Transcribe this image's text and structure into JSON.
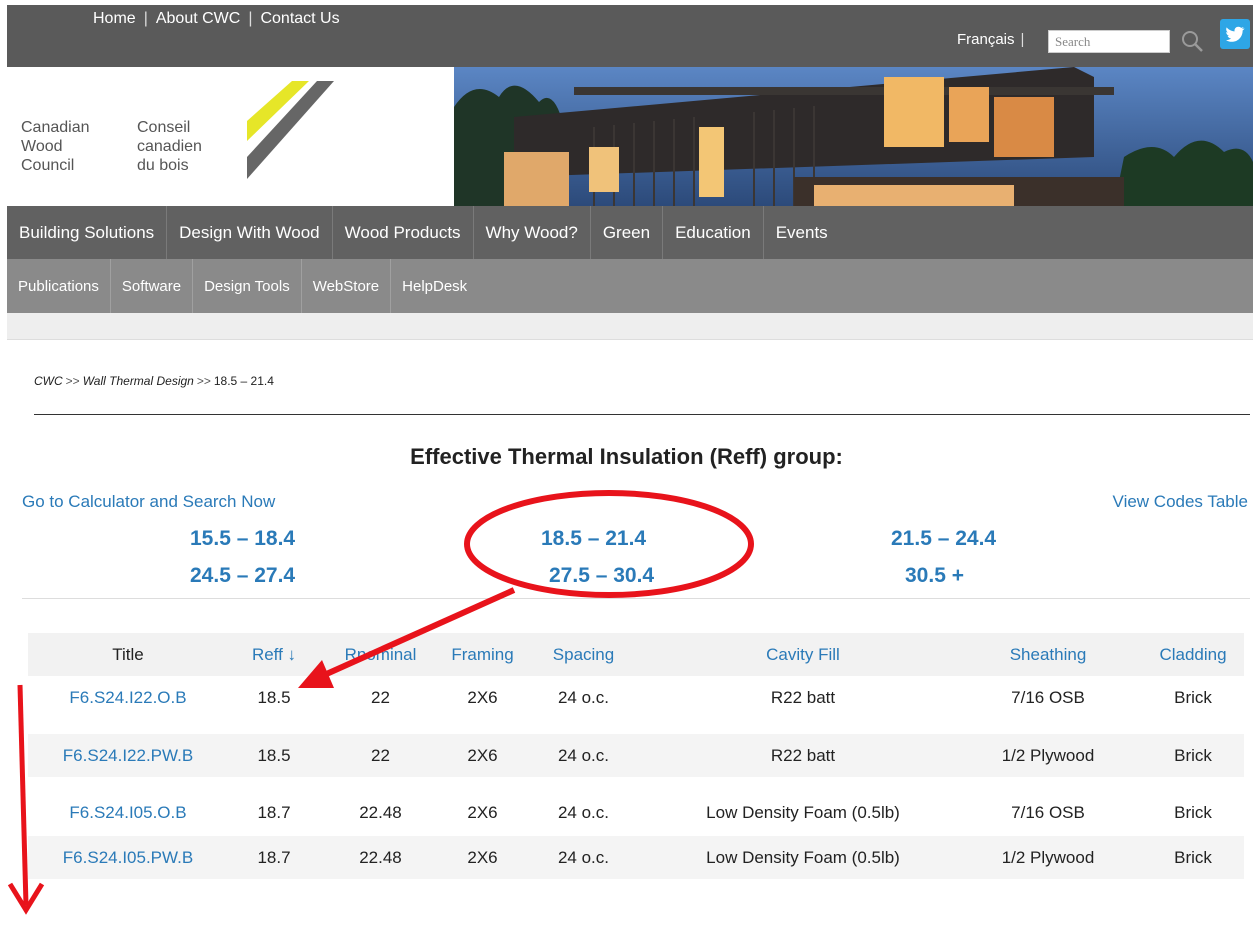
{
  "topbar": {
    "links": [
      "Home",
      "About CWC",
      "Contact Us"
    ],
    "separator": "|",
    "language": "Français",
    "search_placeholder": "Search",
    "accent": "#5a5a5a"
  },
  "logo": {
    "english_lines": [
      "Canadian",
      "Wood",
      "Council"
    ],
    "french_lines": [
      "Conseil",
      "canadien",
      "du bois"
    ],
    "colors": {
      "yellow": "#e6e628",
      "gray": "#666666"
    }
  },
  "main_nav": [
    "Building Solutions",
    "Design With Wood",
    "Wood Products",
    "Why Wood?",
    "Green",
    "Education",
    "Events"
  ],
  "sub_nav": [
    "Publications",
    "Software",
    "Design Tools",
    "WebStore",
    "HelpDesk"
  ],
  "breadcrumb": {
    "root": "CWC",
    "sep": ">>",
    "parent": "Wall Thermal Design",
    "current": "18.5 – 21.4"
  },
  "section": {
    "title": "Effective Thermal Insulation (Reff) group:",
    "calculator_link": "Go to Calculator and Search Now",
    "codes_link": "View Codes Table",
    "ranges": [
      "15.5 – 18.4",
      "18.5 – 21.4",
      "21.5 – 24.4",
      "24.5 – 27.4",
      "27.5 – 30.4",
      "30.5 +"
    ],
    "link_color": "#2a7ab8"
  },
  "table": {
    "columns": [
      "Title",
      "Reff ↓",
      "Rnominal",
      "Framing",
      "Spacing",
      "Cavity Fill",
      "Sheathing",
      "Cladding"
    ],
    "rows": [
      [
        "F6.S24.I22.O.B",
        "18.5",
        "22",
        "2X6",
        "24 o.c.",
        "R22 batt",
        "7/16 OSB",
        "Brick"
      ],
      [
        "F6.S24.I22.PW.B",
        "18.5",
        "22",
        "2X6",
        "24 o.c.",
        "R22 batt",
        "1/2 Plywood",
        "Brick"
      ],
      [
        "F6.S24.I05.O.B",
        "18.7",
        "22.48",
        "2X6",
        "24 o.c.",
        "Low Density Foam (0.5lb)",
        "7/16 OSB",
        "Brick"
      ],
      [
        "F6.S24.I05.PW.B",
        "18.7",
        "22.48",
        "2X6",
        "24 o.c.",
        "Low Density Foam (0.5lb)",
        "1/2 Plywood",
        "Brick"
      ]
    ]
  },
  "annotation": {
    "color": "#e8131b"
  }
}
